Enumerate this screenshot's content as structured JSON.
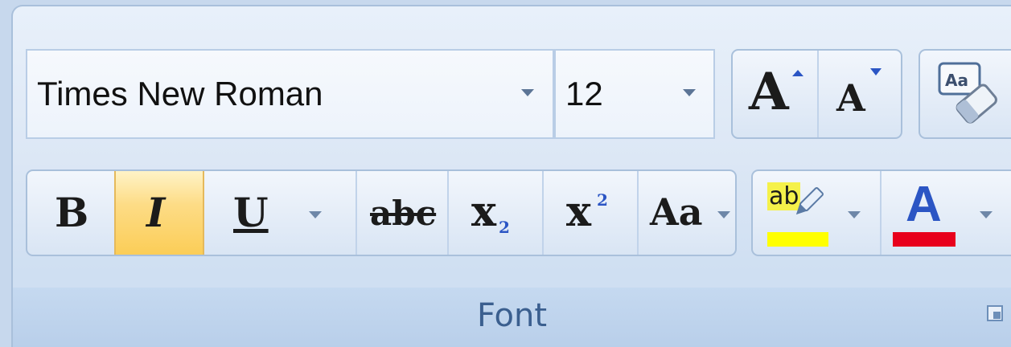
{
  "font_group": {
    "label": "Font",
    "font_name": "Times New Roman",
    "font_size": "12",
    "grow_glyph": "A",
    "shrink_glyph": "A",
    "clear_formatting_text": "Aa"
  },
  "format_buttons": {
    "bold": "B",
    "italic": "I",
    "underline": "U",
    "strikethrough": "abc",
    "subscript_base": "x",
    "subscript_mark": "2",
    "superscript_base": "x",
    "superscript_mark": "2",
    "change_case": "Aa",
    "highlight_text": "ab",
    "font_color_glyph": "A"
  },
  "colors": {
    "highlight_color": "#ffff00",
    "font_color": "#e8001c",
    "active_button": "#fdd46b",
    "font_color_glyph": "#2b55c4"
  },
  "state": {
    "italic_active": true
  },
  "icons": {
    "dropdown_arrow": "chevron-down-icon",
    "clear_formatting": "eraser-icon",
    "dialog_launcher": "dialog-launcher-icon"
  }
}
